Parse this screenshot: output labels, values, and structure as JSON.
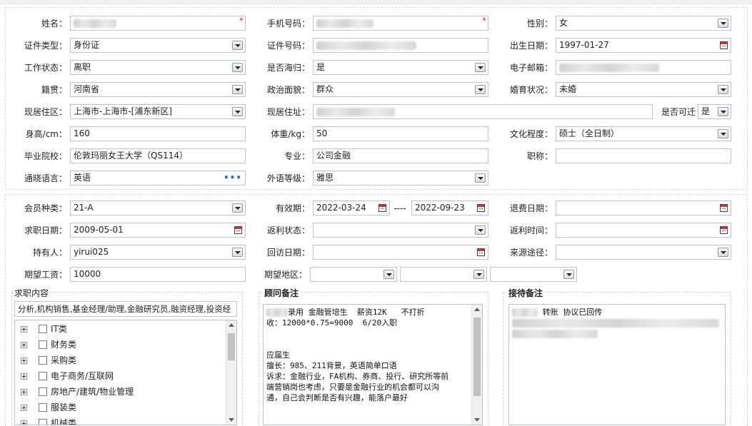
{
  "personal": {
    "name_label": "姓名：",
    "phone_label": "手机号码：",
    "gender_label": "性别：",
    "gender_value": "女",
    "idtype_label": "证件类型：",
    "idtype_value": "身份证",
    "idno_label": "证件号码：",
    "birth_label": "出生日期：",
    "birth_value": "1997-01-27",
    "workstatus_label": "工作状态：",
    "workstatus_value": "离职",
    "overseas_label": "是否海归：",
    "overseas_value": "是",
    "email_label": "电子邮箱：",
    "native_label": "籍贯：",
    "native_value": "河南省",
    "political_label": "政治面貌：",
    "political_value": "群众",
    "marital_label": "婚育状况：",
    "marital_value": "未婚",
    "residence_label": "现居住区：",
    "residence_value": "上海市-上海市-[浦东新区]",
    "address_label": "现居住址：",
    "relocate_label": "是否可迁",
    "relocate_value": "是",
    "height_label": "身高/cm：",
    "height_value": "160",
    "weight_label": "体重/kg：",
    "weight_value": "50",
    "education_label": "文化程度：",
    "education_value": "硕士（全日制）",
    "school_label": "毕业院校：",
    "school_value": "伦敦玛丽女王大学（QS114）",
    "major_label": "专业：",
    "major_value": "公司金融",
    "title_label": "职称：",
    "title_value": "",
    "language_label": "通晓语言：",
    "language_value": "英语",
    "language_more": "•••",
    "foreign_level_label": "外语等级：",
    "foreign_level_value": "雅思"
  },
  "membership": {
    "type_label": "会员种类：",
    "type_value": "21-A",
    "valid_label": "有效期：",
    "valid_from": "2022-03-24",
    "valid_sep": "----",
    "valid_to": "2022-09-23",
    "refund_date_label": "退费日期：",
    "refund_date_value": "",
    "job_date_label": "求职日期：",
    "job_date_value": "2009-05-01",
    "rebate_status_label": "返利状态：",
    "rebate_status_value": "",
    "rebate_time_label": "返利时间：",
    "rebate_time_value": "",
    "holder_label": "持有人：",
    "holder_value": "yirui025",
    "visit_date_label": "回访日期：",
    "visit_date_value": "",
    "source_label": "来源途径：",
    "source_value": "",
    "salary_label": "期望工资：",
    "salary_value": "10000",
    "region_label": "期望地区：",
    "region1": "",
    "region2": "",
    "region3": ""
  },
  "job_content": {
    "title": "求职内容",
    "summary": "分析,机构销售,基金经理/助理,金融研究员,融资经理,投资经",
    "tree": [
      {
        "label": "IT类"
      },
      {
        "label": "财务类"
      },
      {
        "label": "采购类"
      },
      {
        "label": "电子商务/互联网"
      },
      {
        "label": "房地产/建筑/物业管理"
      },
      {
        "label": "服装类"
      },
      {
        "label": "机械类"
      }
    ]
  },
  "consultant_notes": {
    "title": "顾问备注",
    "line1": "录用 金融管培生  薪资12K   不打折",
    "line2": "收：12000*0.75=9000  6/20入职",
    "body": "应届生\n擅长：985、211背景，英语简单口语\n诉求：金融行业，FA机构、券商、投行、研究所等前\n端营销岗也考虑，只要是金融行业的机会都可以沟\n通，自己会判断是否有兴趣，能落户最好"
  },
  "reception_notes": {
    "title": "接待备注",
    "line1": "转账 协议已回传"
  },
  "colors": {
    "border": "#b8c2cc",
    "required": "#e02020",
    "more_dots": "#2a6ed2"
  }
}
